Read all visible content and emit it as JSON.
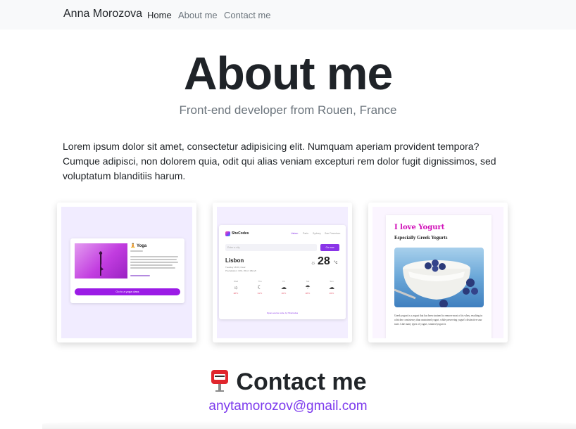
{
  "navbar": {
    "brand": "Anna Morozova",
    "links": [
      {
        "label": "Home",
        "active": true
      },
      {
        "label": "About me",
        "active": false
      },
      {
        "label": "Contact me",
        "active": false
      }
    ]
  },
  "hero": {
    "title": "About me",
    "subtitle": "Front-end developer from Rouen, France"
  },
  "intro": "Lorem ipsum dolor sit amet, consectetur adipisicing elit. Numquam aperiam provident tempora? Cumque adipisci, non dolorem quia, odit qui alias veniam excepturi rem dolor fugit dignissimos, sed voluptatum blanditiis harum.",
  "projects": {
    "yoga": {
      "title": "🧘 Yoga",
      "button": "Go to a yoga class"
    },
    "weather": {
      "brand": "SheCodes",
      "nav": [
        "Lisbon",
        "Paris",
        "Sydney",
        "San Francisco"
      ],
      "search_placeholder": "Enter a city",
      "search_button": "Go now",
      "city": "Lisbon",
      "meta_line1": "Tuesday 18:29, Clear",
      "meta_line2": "Precipitation: 34%, Wind: 18km/h",
      "temperature": "28",
      "unit": "°c",
      "forecast": [
        {
          "day": "Wed",
          "icon": "☼",
          "temp": "28°C"
        },
        {
          "day": "Thu",
          "icon": "☾",
          "temp": "31°C"
        },
        {
          "day": "Fri",
          "icon": "☁",
          "temp": "16°C"
        },
        {
          "day": "Sat",
          "icon": "☂",
          "temp": "18°C"
        },
        {
          "day": "Sun",
          "icon": "☁",
          "temp": "19°C"
        }
      ],
      "footer": "Open-source code, by SheCodes"
    },
    "yogurt": {
      "title": "I love Yogurt",
      "subtitle": "Especially Greek Yogurts",
      "text": "Greek yogurt is a yogurt that has been strained to remove most of its whey, resulting in a thicker consistency than unstrained yogurt, while preserving yogurt's distinctive sour taste. Like many types of yogurt, strained yogurt is"
    }
  },
  "contact": {
    "title": "Contact me",
    "email": "anytamorozov@gmail.com"
  },
  "colors": {
    "accent": "#7c3aed",
    "navbar_bg": "#f8f9fa"
  }
}
